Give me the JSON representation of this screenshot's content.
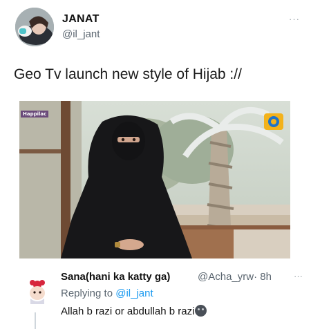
{
  "tweet": {
    "author_name": "JANAT",
    "author_handle": "@il_jant",
    "text": "Geo Tv launch new style of Hijab ://",
    "more_icon": "more-horizontal-icon",
    "media": {
      "channel_watermark": "Happilac",
      "logo_icon": "geo-tv-logo-icon"
    }
  },
  "reply": {
    "author_name": "Sana(hani ka katty ga)",
    "author_handle": "@Acha_yrw",
    "separator": "·",
    "time": "8h",
    "replying_prefix": "Replying to",
    "replying_to": "@il_jant",
    "text": "Allah b razi or abdullah b razi",
    "emoji_icon": "new-moon-face-icon",
    "more_icon": "more-horizontal-icon"
  },
  "colors": {
    "link": "#1d9bf0",
    "secondary_text": "#5b6670"
  }
}
